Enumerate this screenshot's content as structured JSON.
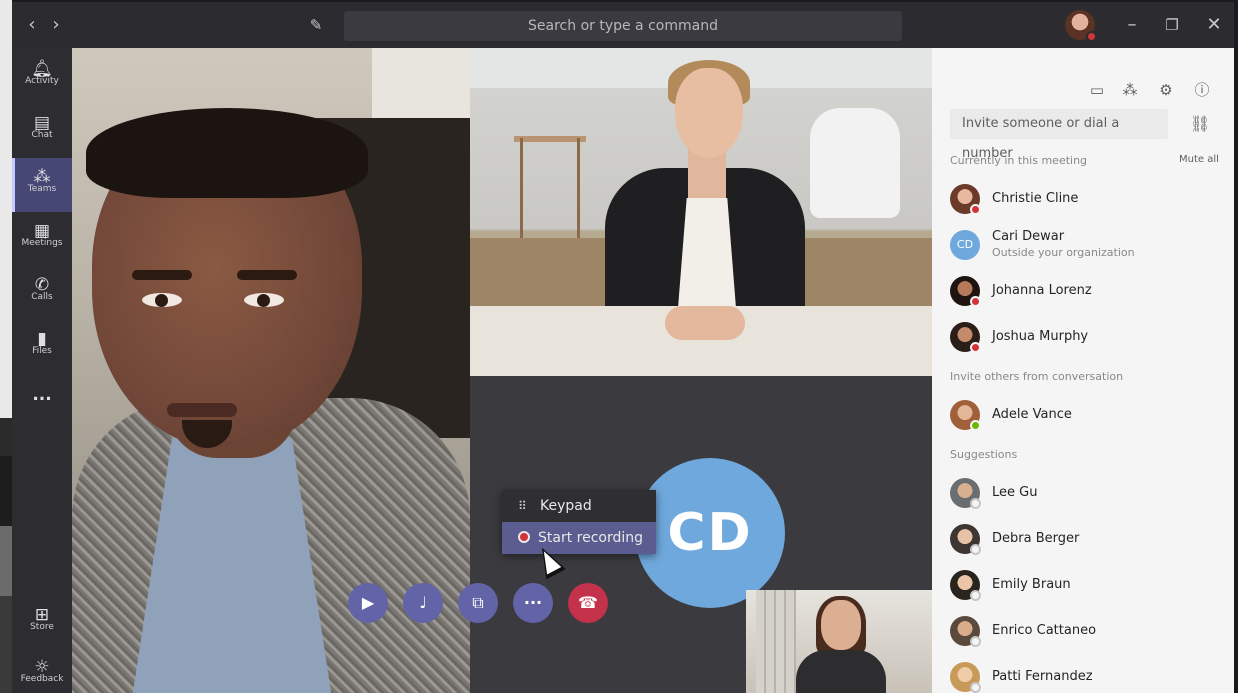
{
  "titlebar": {
    "search_placeholder": "Search or type a command",
    "icons": [
      "chevron-left-icon",
      "chevron-right-icon",
      "compose-icon",
      "minimize-icon",
      "maximize-icon",
      "close-icon"
    ]
  },
  "rail": {
    "items": [
      {
        "label": "Activity",
        "icon": "bell-icon"
      },
      {
        "label": "Chat",
        "icon": "chat-icon"
      },
      {
        "label": "Teams",
        "icon": "teams-icon",
        "active": true
      },
      {
        "label": "Meetings",
        "icon": "calendar-icon"
      },
      {
        "label": "Calls",
        "icon": "phone-icon"
      },
      {
        "label": "Files",
        "icon": "file-icon"
      }
    ],
    "more": "...",
    "store_label": "Store",
    "feedback_label": "Feedback"
  },
  "stage": {
    "cd_initials": "CD",
    "menu": {
      "keypad": "Keypad",
      "start_recording": "Start recording"
    },
    "controls": [
      "video-icon",
      "mic-icon",
      "share-screen-icon",
      "more-icon",
      "hang-up-icon"
    ]
  },
  "panel": {
    "invite_placeholder": "Invite someone or dial a number",
    "current_heading": "Currently in this meeting",
    "mute_all": "Mute all",
    "current": [
      {
        "name": "Christie Cline",
        "status": "busy"
      },
      {
        "name": "Cari Dewar",
        "sub": "Outside your organization",
        "initials": "CD"
      },
      {
        "name": "Johanna Lorenz",
        "status": "busy"
      },
      {
        "name": "Joshua Murphy",
        "status": "busy"
      }
    ],
    "invite_heading": "Invite others from conversation",
    "invite_people": [
      {
        "name": "Adele Vance",
        "status": "available"
      }
    ],
    "suggestions_heading": "Suggestions",
    "suggestions": [
      {
        "name": "Lee Gu",
        "status": "offline"
      },
      {
        "name": "Debra Berger",
        "status": "offline"
      },
      {
        "name": "Emily Braun",
        "status": "offline"
      },
      {
        "name": "Enrico Cattaneo",
        "status": "offline"
      },
      {
        "name": "Patti Fernandez",
        "status": "offline"
      }
    ]
  },
  "colors": {
    "accent": "#6264a7",
    "hangup": "#c4314b",
    "busy": "#d13438",
    "available": "#6bb700",
    "cd_avatar": "#6fa8dc"
  }
}
